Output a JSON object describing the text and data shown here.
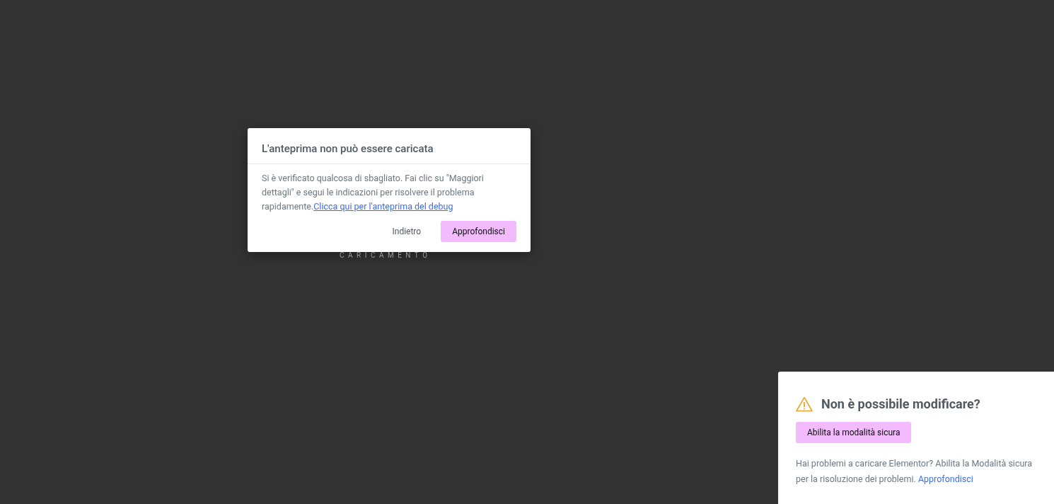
{
  "loading": {
    "label": "CARICAMENTO"
  },
  "dialog": {
    "title": "L'anteprima non può essere caricata",
    "message": "Si è verificato qualcosa di sbagliato. Fai clic su \"Maggiori dettagli\" e segui le indicazioni per risolvere il problema rapidamente.",
    "link": "Clicca qui per l'anteprima del debug",
    "buttons": [
      {
        "label": "Indietro",
        "kind": "secondary"
      },
      {
        "label": "Approfondisci",
        "kind": "primary"
      }
    ]
  },
  "safe_mode": {
    "title": "Non è possibile modificare?",
    "button": "Abilita la modalità sicura",
    "message": "Hai problemi a caricare Elementor? Abilita la Modalità sicura per la risoluzione dei problemi.",
    "link": "Approfondisci"
  }
}
